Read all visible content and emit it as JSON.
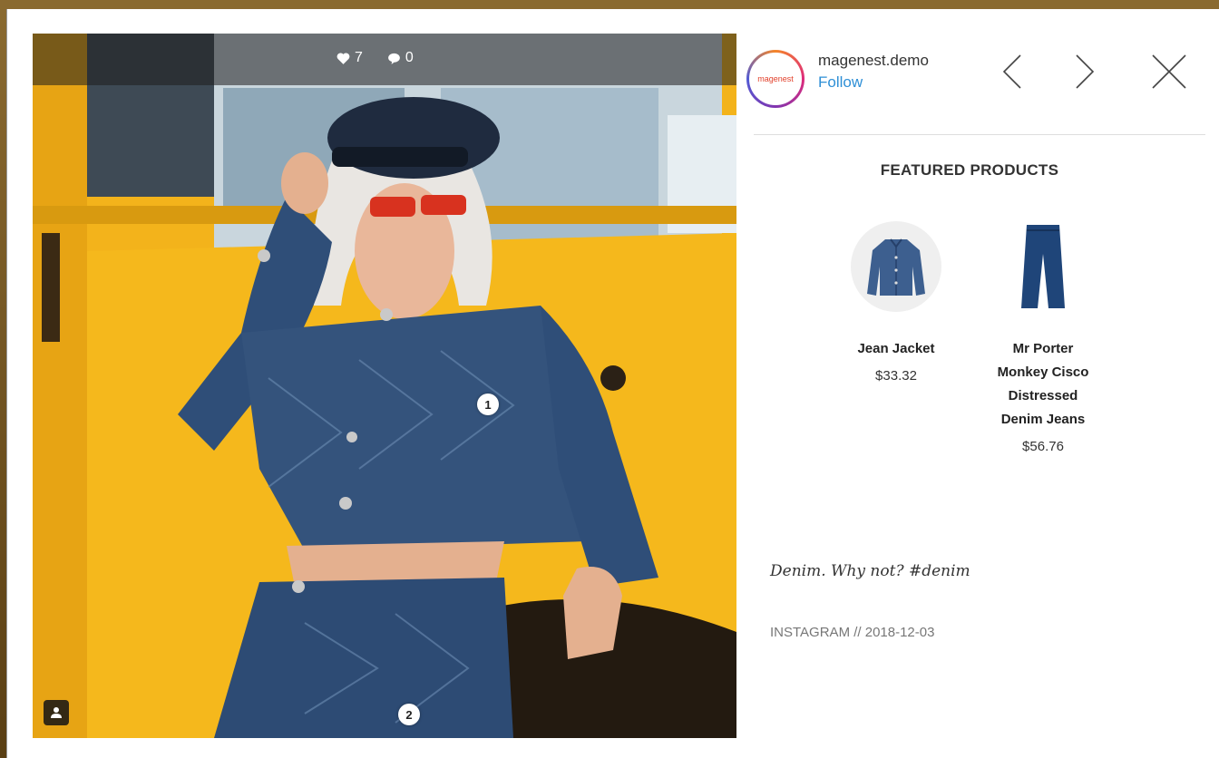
{
  "post": {
    "likes": "7",
    "comments": "0",
    "hotspots": [
      "1",
      "2"
    ],
    "caption": "Denim. Why not? #denim",
    "source": "INSTAGRAM // 2018-12-03"
  },
  "account": {
    "username": "magenest.demo",
    "follow_label": "Follow",
    "avatar_text": "magenest"
  },
  "featured": {
    "title": "FEATURED PRODUCTS",
    "products": [
      {
        "name": "Jean Jacket",
        "price": "$33.32"
      },
      {
        "name": "Mr Porter Monkey Cisco Distressed Denim Jeans",
        "price": "$56.76"
      }
    ]
  },
  "colors": {
    "accent": "#2e8fd6",
    "bus_yellow": "#f2b21a",
    "denim": "#2f4e78"
  },
  "icons": [
    "heart-icon",
    "comment-icon",
    "user-tag-icon",
    "chevron-left-icon",
    "chevron-right-icon",
    "close-icon"
  ]
}
